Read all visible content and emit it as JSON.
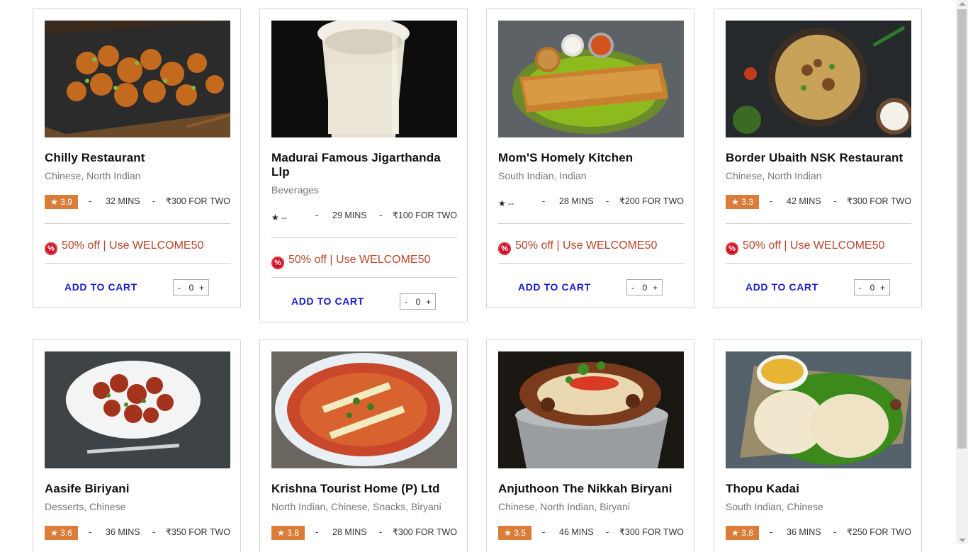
{
  "cards": [
    {
      "name": "Chilly Restaurant",
      "cuisine": "Chinese, North Indian",
      "rating": "3.9",
      "mins": "32 MINS",
      "price": "₹300 FOR TWO",
      "offer": "50% off | Use WELCOME50",
      "add": "ADD TO CART",
      "qty": "0",
      "minus": "-",
      "plus": "+",
      "dash": "-",
      "badge": "%",
      "image": "chilli-chicken-image"
    },
    {
      "name": "Madurai Famous Jigarthanda Llp",
      "cuisine": "Beverages",
      "rating": "--",
      "mins": "29 MINS",
      "price": "₹100 FOR TWO",
      "offer": "50% off | Use WELCOME50",
      "add": "ADD TO CART",
      "qty": "0",
      "minus": "-",
      "plus": "+",
      "dash": "-",
      "badge": "%",
      "image": "jigarthanda-drink-image"
    },
    {
      "name": "Mom'S Homely Kitchen",
      "cuisine": "South Indian, Indian",
      "rating": "--",
      "mins": "28 MINS",
      "price": "₹200 FOR TWO",
      "offer": "50% off | Use WELCOME50",
      "add": "ADD TO CART",
      "qty": "0",
      "minus": "-",
      "plus": "+",
      "dash": "-",
      "badge": "%",
      "image": "dosa-image"
    },
    {
      "name": "Border Ubaith NSK Restaurant",
      "cuisine": "Chinese, North Indian",
      "rating": "3.3",
      "mins": "42 MINS",
      "price": "₹300 FOR TWO",
      "offer": "50% off | Use WELCOME50",
      "add": "ADD TO CART",
      "qty": "0",
      "minus": "-",
      "plus": "+",
      "dash": "-",
      "badge": "%",
      "image": "biryani-bowl-image"
    },
    {
      "name": "Aasife Biriyani",
      "cuisine": "Desserts, Chinese",
      "rating": "3.6",
      "mins": "36 MINS",
      "price": "₹350 FOR TWO",
      "image": "chilli-chicken-plate-image",
      "dash": "-"
    },
    {
      "name": "Krishna Tourist Home (P) Ltd",
      "cuisine": "North Indian, Chinese, Snacks, Biryani",
      "rating": "3.8",
      "mins": "28 MINS",
      "price": "₹300 FOR TWO",
      "image": "curry-bowl-image",
      "dash": "-"
    },
    {
      "name": "Anjuthoon The Nikkah Biryani",
      "cuisine": "Chinese, North Indian, Biryani",
      "rating": "3.5",
      "mins": "46 MINS",
      "price": "₹300 FOR TWO",
      "image": "nikkah-biryani-image",
      "dash": "-"
    },
    {
      "name": "Thopu Kadai",
      "cuisine": "South Indian, Chinese",
      "rating": "3.8",
      "mins": "36 MINS",
      "price": "₹250 FOR TWO",
      "image": "parotta-image",
      "dash": "-"
    }
  ],
  "colors": {
    "rating_bg": "#db7c38",
    "offer_text": "#b5462d",
    "add_to_cart": "#1a1acc",
    "offer_badge": "#c8102e"
  },
  "icons": {
    "rating": "star-icon",
    "offer": "discount-badge-icon"
  }
}
